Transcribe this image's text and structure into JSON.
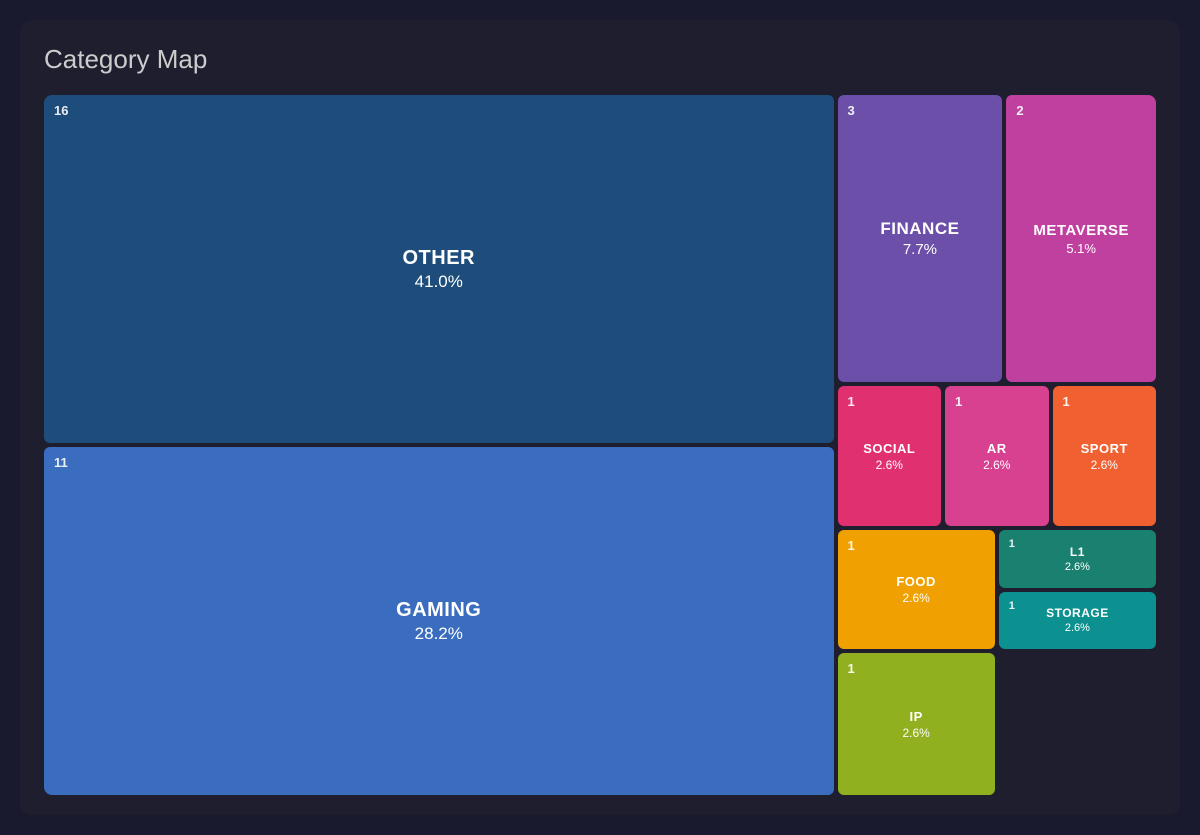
{
  "title": "Category Map",
  "cells": {
    "other": {
      "count": "16",
      "label": "OTHER",
      "pct": "41.0%"
    },
    "gaming": {
      "count": "11",
      "label": "GAMING",
      "pct": "28.2%"
    },
    "finance": {
      "count": "3",
      "label": "FINANCE",
      "pct": "7.7%"
    },
    "metaverse": {
      "count": "2",
      "label": "METAVERSE",
      "pct": "5.1%"
    },
    "social": {
      "count": "1",
      "label": "SOCIAL",
      "pct": "2.6%"
    },
    "ar": {
      "count": "1",
      "label": "AR",
      "pct": "2.6%"
    },
    "sport": {
      "count": "1",
      "label": "SPORT",
      "pct": "2.6%"
    },
    "food": {
      "count": "1",
      "label": "FOOD",
      "pct": "2.6%"
    },
    "l1": {
      "count": "1",
      "label": "L1",
      "pct": "2.6%"
    },
    "storage": {
      "count": "1",
      "label": "STORAGE",
      "pct": "2.6%"
    },
    "ip": {
      "count": "1",
      "label": "IP",
      "pct": "2.6%"
    }
  }
}
